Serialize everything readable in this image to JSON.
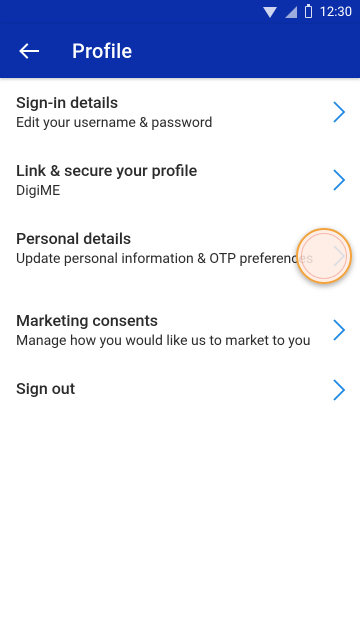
{
  "status_bar": {
    "time": "12:30",
    "icons": [
      "wifi-icon",
      "signal-icon",
      "battery-icon"
    ]
  },
  "app_bar": {
    "back_icon": "arrow-left-icon",
    "title": "Profile",
    "background": "#0b2faa"
  },
  "menu": {
    "chevron_color": "#1e88e5",
    "items": [
      {
        "title": "Sign-in details",
        "subtitle": "Edit your username & password"
      },
      {
        "title": "Link & secure your profile",
        "subtitle": "DigiME"
      },
      {
        "title": "Personal details",
        "subtitle": "Update personal information & OTP preferences"
      },
      {
        "title": "Marketing consents",
        "subtitle": "Manage how you would like us to market to you"
      },
      {
        "title": "Sign out",
        "subtitle": ""
      }
    ]
  }
}
